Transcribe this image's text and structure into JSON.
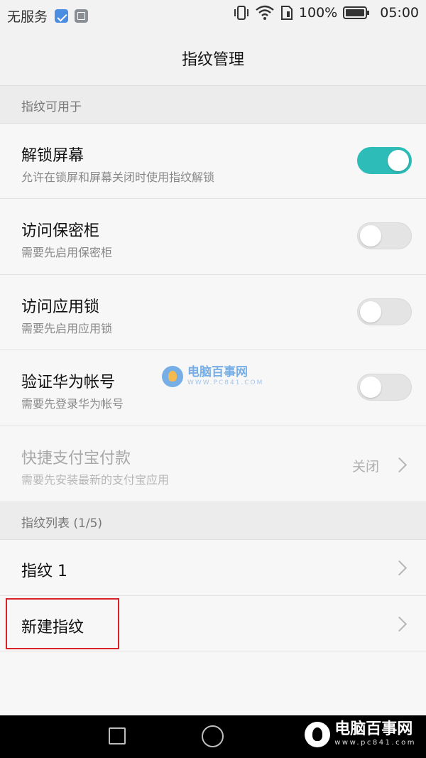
{
  "status_bar": {
    "carrier": "无服务",
    "icons_left": [
      "health-app-icon",
      "gallery-notification-icon"
    ],
    "icons_right": [
      "vibrate-icon",
      "wifi-icon",
      "sim-icon"
    ],
    "battery_percent": "100%",
    "time": "05:00"
  },
  "header": {
    "title": "指纹管理"
  },
  "sections": {
    "usage_header": "指纹可用于",
    "list_header": "指纹列表 (1/5)"
  },
  "usage_items": [
    {
      "title": "解锁屏幕",
      "subtitle": "允许在锁屏和屏幕关闭时使用指纹解锁",
      "toggle": "on"
    },
    {
      "title": "访问保密柜",
      "subtitle": "需要先启用保密柜",
      "toggle": "off"
    },
    {
      "title": "访问应用锁",
      "subtitle": "需要先启用应用锁",
      "toggle": "off"
    },
    {
      "title": "验证华为帐号",
      "subtitle": "需要先登录华为帐号",
      "toggle": "off"
    },
    {
      "title": "快捷支付宝付款",
      "subtitle": "需要先安装最新的支付宝应用",
      "value": "关闭",
      "disabled": true
    }
  ],
  "fingerprint_items": [
    {
      "title": "指纹 1"
    },
    {
      "title": "新建指纹"
    }
  ],
  "watermark": {
    "title": "电脑百事网",
    "url": "WWW.PC841.COM",
    "nav_url": "www.pc841.com"
  },
  "colors": {
    "toggle_on": "#2ebcb8",
    "highlight": "#d9232a"
  }
}
